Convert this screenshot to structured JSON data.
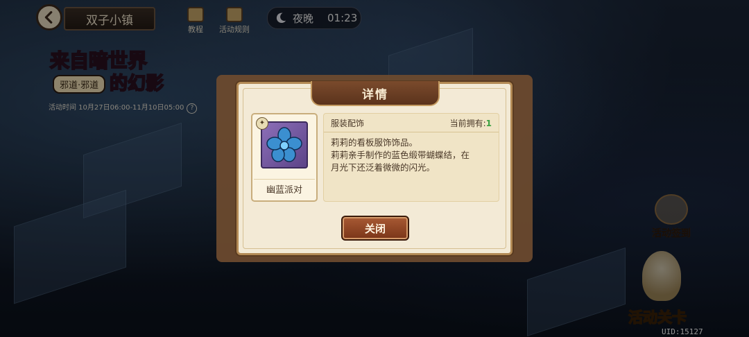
{
  "header": {
    "town_title": "双子小镇",
    "tutorial_label": "教程",
    "rules_label": "活动规则",
    "night_label": "夜晚",
    "night_time": "01:23"
  },
  "event": {
    "title_line1": "来自暗世界",
    "title_line2": "的幻影",
    "tag": "邪道·邪道",
    "time_text": "活动时间 10月27日06:00-11月10日05:00"
  },
  "side": {
    "sign_in_label": "活动签到",
    "stage_label": "活动关卡",
    "uid": "UID:15127"
  },
  "modal": {
    "title": "详情",
    "item_name": "幽蓝派对",
    "category": "服装配饰",
    "owned_label": "当前拥有:",
    "owned_count": "1",
    "desc_line1": "莉莉的看板服饰饰品。",
    "desc_line2": "莉莉亲手制作的蓝色缎带蝴蝶结，在",
    "desc_line3": "月光下还泛着微微的闪光。",
    "close_label": "关闭"
  },
  "colors": {
    "modal_bg": "#f3ead6",
    "title_tab": "#6b3d22",
    "owned_count": "#3aa040"
  }
}
